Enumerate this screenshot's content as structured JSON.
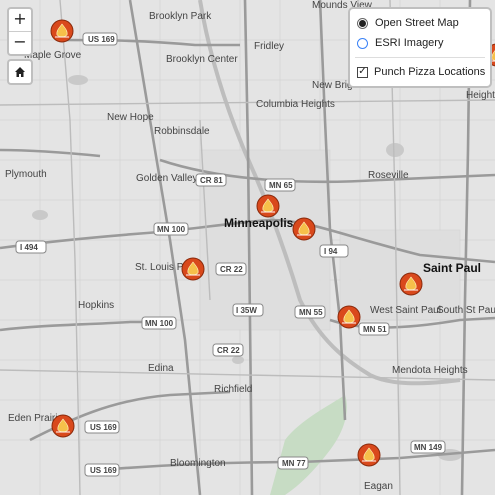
{
  "controls": {
    "zoom_in": "+",
    "zoom_out": "−",
    "home_icon": "home-icon"
  },
  "layers": {
    "base_layers": [
      {
        "label": "Open Street Map",
        "selected": true
      },
      {
        "label": "ESRI Imagery",
        "selected": false
      }
    ],
    "overlays": [
      {
        "label": "Punch Pizza Locations",
        "checked": true
      }
    ]
  },
  "map": {
    "cities": {
      "minneapolis": "Minneapolis",
      "saint_paul": "Saint Paul",
      "brooklyn_park": "Brooklyn Park",
      "brooklyn_center": "Brooklyn Center",
      "maple_grove": "Maple Grove",
      "fridley": "Fridley",
      "mounds_view": "Mounds View",
      "new_brighton": "New Brighton",
      "columbia_heights": "Columbia Heights",
      "new_hope": "New Hope",
      "robbinsdale": "Robbinsdale",
      "plymouth": "Plymouth",
      "golden_valley": "Golden Valley",
      "roseville": "Roseville",
      "st_louis_park": "St. Louis Park",
      "hopkins": "Hopkins",
      "edina": "Edina",
      "richfield": "Richfield",
      "west_saint_paul": "West Saint Paul",
      "south_st_paul": "South St Paul",
      "mendota_heights": "Mendota Heights",
      "eden_prairie": "Eden Prairie",
      "bloomington": "Bloomington",
      "eagan": "Eagan",
      "heights": "Heights"
    },
    "shields": [
      "US 169",
      "MN 65",
      "CR 81",
      "MN 100",
      "I 494",
      "CR 22",
      "I 94",
      "MN 100",
      "I 35W",
      "MN 55",
      "MN 51",
      "CR 22",
      "US 169",
      "US 169",
      "MN 77",
      "MN 149"
    ],
    "marker_icon": "pizza-flame-icon"
  }
}
